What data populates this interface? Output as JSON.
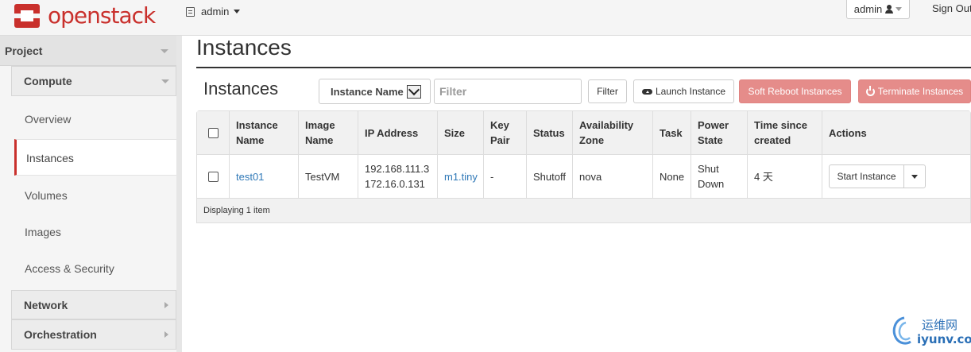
{
  "topbar": {
    "brand": "openstack",
    "project_switcher": "admin",
    "user_menu": "admin",
    "sign_out": "Sign Out"
  },
  "sidebar": {
    "dashboard": "Project",
    "sections": [
      {
        "label": "Compute",
        "expanded": true
      },
      {
        "label": "Network",
        "expanded": false
      },
      {
        "label": "Orchestration",
        "expanded": false
      }
    ],
    "items": [
      "Overview",
      "Instances",
      "Volumes",
      "Images",
      "Access & Security"
    ],
    "active_item": "Instances"
  },
  "page": {
    "title": "Instances"
  },
  "table_panel": {
    "title": "Instances",
    "filter_field": "Instance Name",
    "filter_placeholder": "Filter",
    "filter_button": "Filter",
    "launch_button": "Launch Instance",
    "soft_reboot_button": "Soft Reboot Instances",
    "terminate_button": "Terminate Instances"
  },
  "table": {
    "headers": {
      "name": [
        "Instance",
        "Name"
      ],
      "image": [
        "Image",
        "Name"
      ],
      "ip": "IP Address",
      "size": "Size",
      "keypair": [
        "Key",
        "Pair"
      ],
      "status": "Status",
      "zone": [
        "Availability",
        "Zone"
      ],
      "task": "Task",
      "power": [
        "Power",
        "State"
      ],
      "time": [
        "Time since",
        "created"
      ],
      "actions": "Actions"
    },
    "rows": [
      {
        "name": "test01",
        "image": "TestVM",
        "ip": [
          "192.168.111.3",
          "172.16.0.131"
        ],
        "size": "m1.tiny",
        "keypair": "-",
        "status": "Shutoff",
        "zone": "nova",
        "task": "None",
        "power": [
          "Shut",
          "Down"
        ],
        "time": "4 天",
        "action": "Start Instance"
      }
    ],
    "footer": "Displaying 1 item"
  },
  "watermark": {
    "cn": "运维网",
    "en": "iyunv.com"
  },
  "colors": {
    "brand_red": "#c9302c",
    "danger_button": "#e58c8a",
    "link_blue": "#2f78b7"
  },
  "icons": [
    "openstack-logo",
    "project-doc-icon",
    "user-icon",
    "cloud-upload-icon",
    "power-icon",
    "caret-icon"
  ]
}
